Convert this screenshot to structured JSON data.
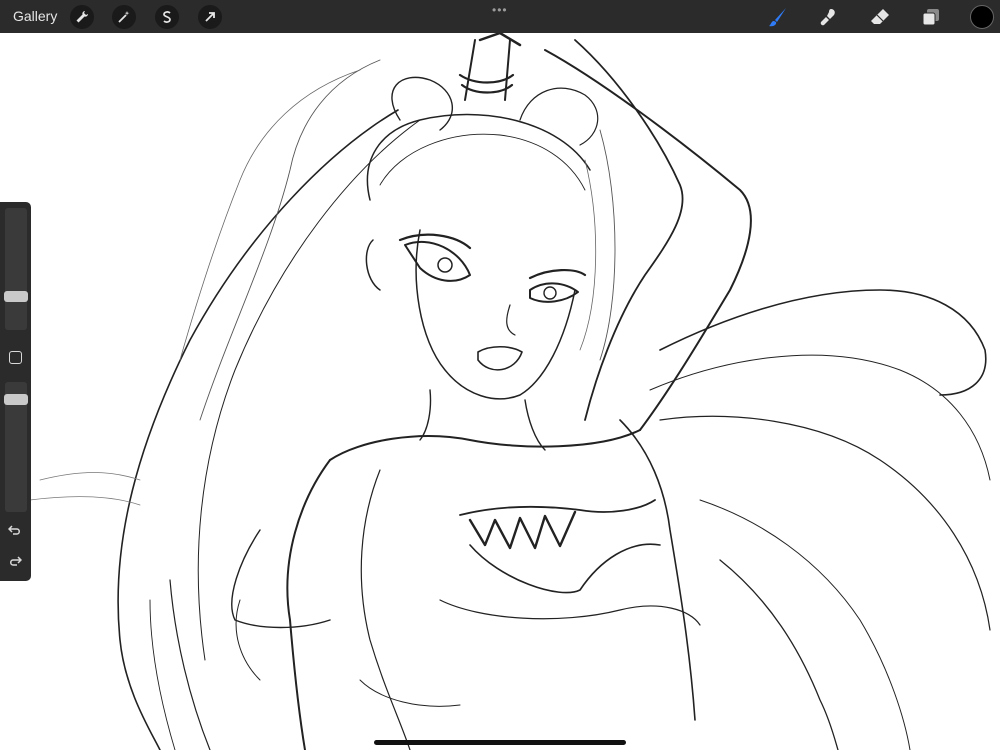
{
  "topbar": {
    "gallery_label": "Gallery",
    "left_tools": [
      "wrench-icon",
      "magic-wand-icon",
      "selection-icon",
      "transform-arrow-icon"
    ],
    "more_indicator": "•••",
    "right_tools": [
      "brush-icon",
      "smudge-icon",
      "eraser-icon",
      "layers-icon"
    ],
    "active_tool": "brush-icon",
    "accent_color": "#2f7bf6",
    "current_color": "#000000"
  },
  "sidebar": {
    "brush_size_level": 0.25,
    "opacity_level": 0.9,
    "undo_icon": "undo-icon",
    "redo_icon": "redo-icon"
  }
}
